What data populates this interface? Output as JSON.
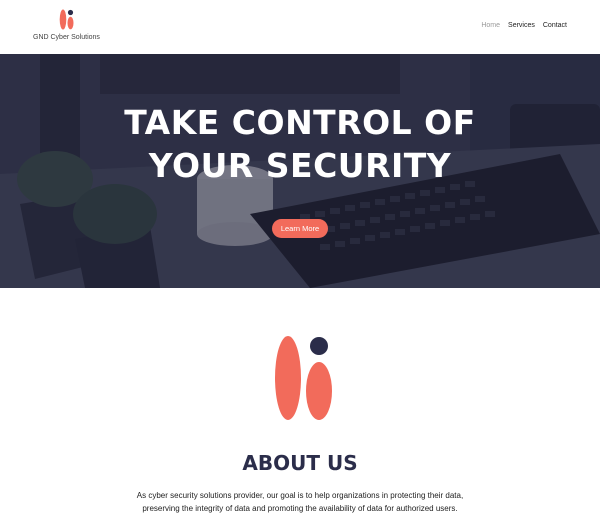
{
  "brand": {
    "name": "GND Cyber Solutions",
    "accent_color": "#f26b5b",
    "dark_color": "#2b2d4a"
  },
  "nav": {
    "items": [
      {
        "label": "Home",
        "active": true
      },
      {
        "label": "Services",
        "active": false
      },
      {
        "label": "Contact",
        "active": false
      }
    ]
  },
  "hero": {
    "title_line1": "TAKE CONTROL OF",
    "title_line2": "YOUR SECURITY",
    "button_label": "Learn More",
    "background_image": "desk-keyboard-plants-photo"
  },
  "about": {
    "logo_icon": "brand-mark-icon",
    "title": "ABOUT US",
    "text": "As cyber security solutions provider, our goal is to help organizations in protecting their data, preserving the integrity of data and promoting the availability of data for authorized users."
  }
}
